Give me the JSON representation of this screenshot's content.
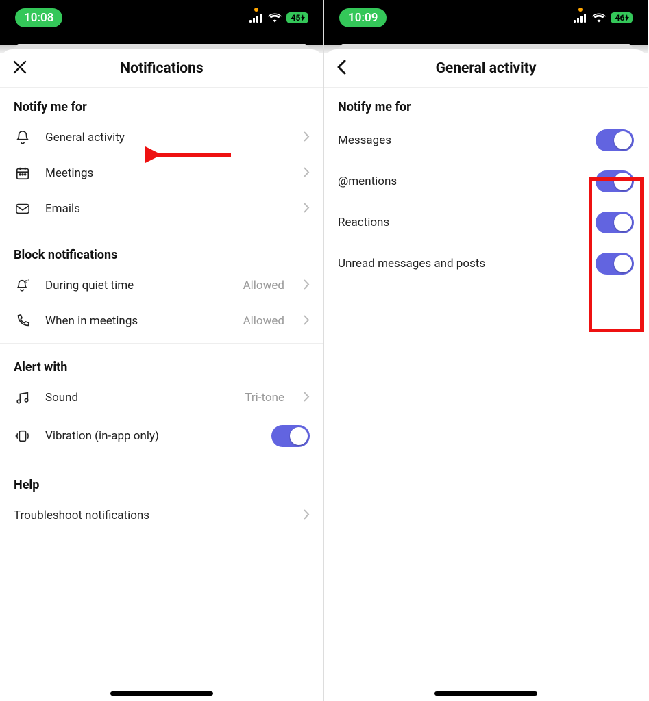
{
  "left": {
    "status": {
      "time": "10:08",
      "battery": "45"
    },
    "title": "Notifications",
    "sections": {
      "notify_header": "Notify me for",
      "notify_items": [
        {
          "label": "General activity"
        },
        {
          "label": "Meetings"
        },
        {
          "label": "Emails"
        }
      ],
      "block_header": "Block notifications",
      "block_items": [
        {
          "label": "During quiet time",
          "value": "Allowed"
        },
        {
          "label": "When in meetings",
          "value": "Allowed"
        }
      ],
      "alert_header": "Alert with",
      "alert_items": {
        "sound": {
          "label": "Sound",
          "value": "Tri-tone"
        },
        "vibration": {
          "label": "Vibration (in-app only)"
        }
      },
      "help_header": "Help",
      "help_item": {
        "label": "Troubleshoot notifications"
      }
    }
  },
  "right": {
    "status": {
      "time": "10:09",
      "battery": "46"
    },
    "title": "General activity",
    "section_header": "Notify me for",
    "items": [
      {
        "label": "Messages"
      },
      {
        "label": "@mentions"
      },
      {
        "label": "Reactions"
      },
      {
        "label": "Unread messages and posts"
      }
    ]
  }
}
